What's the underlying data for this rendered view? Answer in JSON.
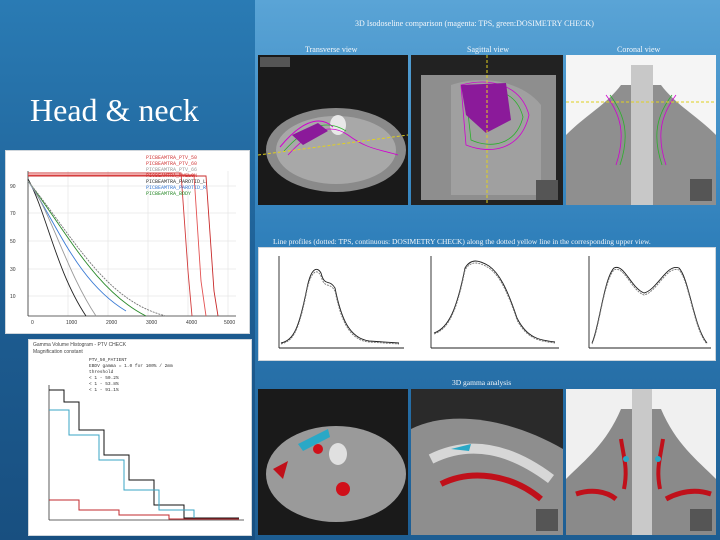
{
  "slide": {
    "title": "Head & neck",
    "top_caption": "3D Isodoseline comparison (magenta: TPS, green:DOSIMETRY CHECK)",
    "views": {
      "transverse": "Transverse view",
      "sagittal": "Sagittal view",
      "coronal": "Coronal view"
    },
    "line_caption": "Line profiles (dotted: TPS, continuous: DOSIMETRY CHECK) along the dotted yellow line in the corresponding upper view.",
    "gamma_caption": "3D gamma analysis"
  },
  "dvh": {
    "legend": [
      "PICBEAMTRA_PTV_50",
      "PICBEAMTRA_PTV_60",
      "PICBEAMTRA_PTV_66",
      "PICBEAMTRA_MYELON",
      "PICBEAMTRA_PAROTID_L",
      "PICBEAMTRA_PAROTID_R",
      "PICBEAMTRA_BODY"
    ],
    "legend_colors": [
      "#d23b3b",
      "#d23b3b",
      "#999999",
      "#d23b3b",
      "#333333",
      "#3a7bd5",
      "#2a8a2a"
    ]
  },
  "gamma_hist": {
    "header_line1": "Gamma Volume Histogram - PTV CHECK",
    "header_line2": "Magnification constant",
    "legend_lines": [
      "PTV_50_PATIENT",
      "EBDV gamma = 1.0 for 100% / 2mm",
      "threshold",
      "< 1 - 50.2%",
      "< 1 - 53.8%",
      "< 1 - 91.1%"
    ]
  }
}
